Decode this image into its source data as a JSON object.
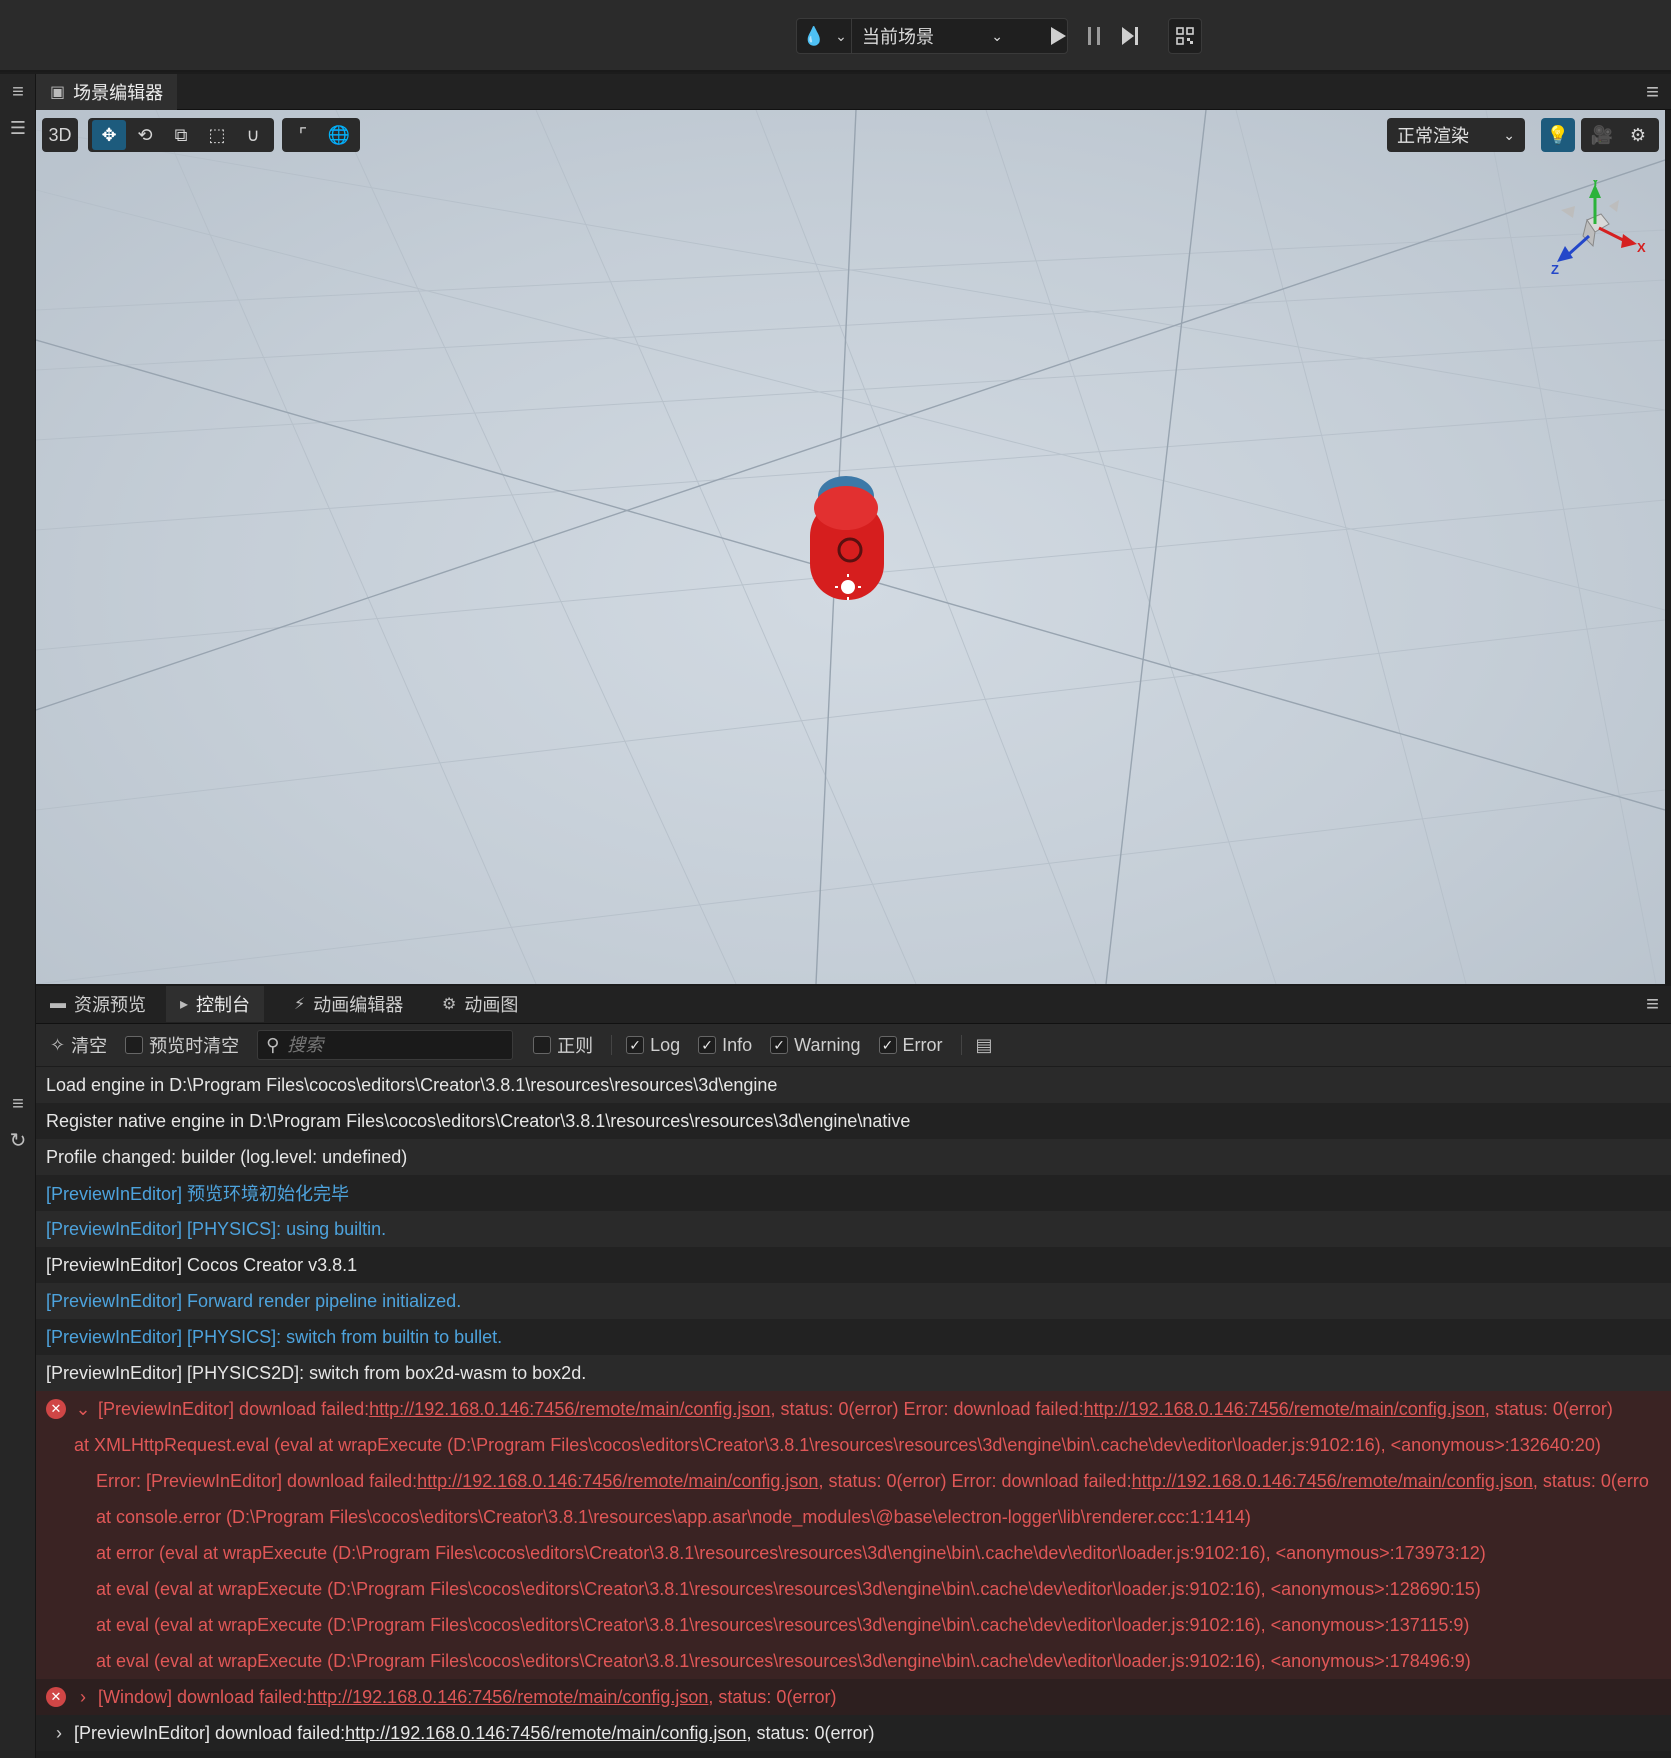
{
  "topbar": {
    "scene_select": "当前场景"
  },
  "scene_panel": {
    "tab_label": "场景编辑器",
    "mode_label": "3D",
    "render_mode": "正常渲染",
    "gizmo": {
      "x_label": "X",
      "y_label": "Y",
      "z_label": "Z"
    }
  },
  "console_panel": {
    "tabs": [
      {
        "label": "资源预览"
      },
      {
        "label": "控制台"
      },
      {
        "label": "动画编辑器"
      },
      {
        "label": "动画图"
      }
    ],
    "tools": {
      "clear_label": "清空",
      "clear_on_preview_label": "预览时清空",
      "search_placeholder": "搜索",
      "regex_label": "正则",
      "log_label": "Log",
      "info_label": "Info",
      "warning_label": "Warning",
      "error_label": "Error"
    },
    "logs": [
      {
        "text": "Load engine in D:\\Program Files\\cocos\\editors\\Creator\\3.8.1\\resources\\resources\\3d\\engine"
      },
      {
        "text": "Register native engine in D:\\Program Files\\cocos\\editors\\Creator\\3.8.1\\resources\\resources\\3d\\engine\\native"
      },
      {
        "text": "Profile changed: builder (log.level: undefined)"
      },
      {
        "text": "[PreviewInEditor] 预览环境初始化完毕"
      },
      {
        "text": "[PreviewInEditor] [PHYSICS]: using builtin."
      },
      {
        "text": "[PreviewInEditor] Cocos Creator v3.8.1"
      },
      {
        "text": "[PreviewInEditor] Forward render pipeline initialized."
      },
      {
        "text": "[PreviewInEditor] [PHYSICS]: switch from builtin to bullet."
      },
      {
        "text": "[PreviewInEditor] [PHYSICS2D]: switch from box2d-wasm to box2d."
      }
    ],
    "error1": {
      "prefix": "[PreviewInEditor] download failed: ",
      "url": "http://192.168.0.146:7456/remote/main/config.json",
      "middle": " , status: 0(error) Error: download failed: ",
      "url2": "http://192.168.0.146:7456/remote/main/config.json",
      "suffix": " , status: 0(error)",
      "stack": [
        "at XMLHttpRequest.eval (eval at wrapExecute (D:\\Program Files\\cocos\\editors\\Creator\\3.8.1\\resources\\resources\\3d\\engine\\bin\\.cache\\dev\\editor\\loader.js:9102:16), <anonymous>:132640:20)"
      ],
      "sub_prefix": "Error: [PreviewInEditor] download failed: ",
      "sub_url": "http://192.168.0.146:7456/remote/main/config.json",
      "sub_middle": " , status: 0(error) Error: download failed: ",
      "sub_url2": "http://192.168.0.146:7456/remote/main/config.json",
      "sub_suffix": " , status: 0(erro",
      "sub_stack": [
        "at console.error (D:\\Program Files\\cocos\\editors\\Creator\\3.8.1\\resources\\app.asar\\node_modules\\@base\\electron-logger\\lib\\renderer.ccc:1:1414)",
        "at error (eval at wrapExecute (D:\\Program Files\\cocos\\editors\\Creator\\3.8.1\\resources\\resources\\3d\\engine\\bin\\.cache\\dev\\editor\\loader.js:9102:16), <anonymous>:173973:12)",
        "at eval (eval at wrapExecute (D:\\Program Files\\cocos\\editors\\Creator\\3.8.1\\resources\\resources\\3d\\engine\\bin\\.cache\\dev\\editor\\loader.js:9102:16), <anonymous>:128690:15)",
        "at eval (eval at wrapExecute (D:\\Program Files\\cocos\\editors\\Creator\\3.8.1\\resources\\resources\\3d\\engine\\bin\\.cache\\dev\\editor\\loader.js:9102:16), <anonymous>:137115:9)",
        "at eval (eval at wrapExecute (D:\\Program Files\\cocos\\editors\\Creator\\3.8.1\\resources\\resources\\3d\\engine\\bin\\.cache\\dev\\editor\\loader.js:9102:16), <anonymous>:178496:9)"
      ]
    },
    "error2": {
      "prefix": "[Window] download failed: ",
      "url": "http://192.168.0.146:7456/remote/main/config.json",
      "suffix": " , status: 0(error)"
    },
    "log_last": {
      "prefix": "[PreviewInEditor] download failed: ",
      "url": "http://192.168.0.146:7456/remote/main/config.json",
      "suffix": " , status: 0(error)"
    }
  },
  "colors": {
    "info": "#4da3dd",
    "error": "#e05757",
    "accent": "#1d5b7d",
    "capsule": "#d61e1e"
  }
}
